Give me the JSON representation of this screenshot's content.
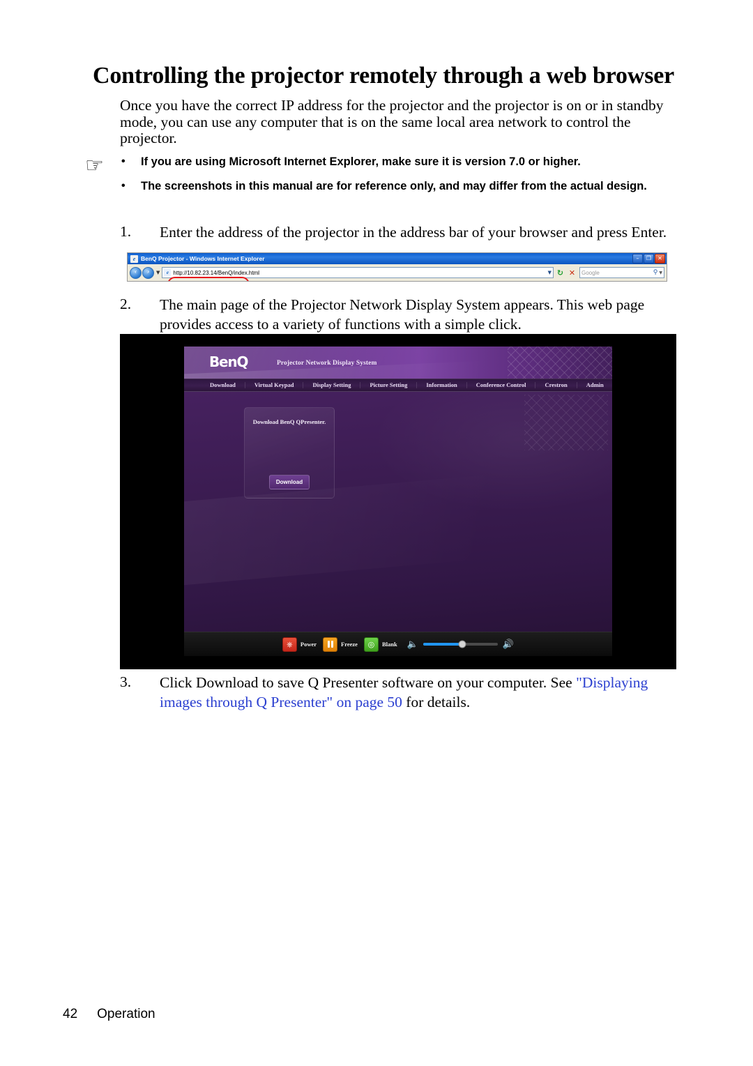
{
  "page": {
    "title": "Controlling the projector remotely through a web browser",
    "intro": "Once you have the correct IP address for the projector and the projector is on or in standby mode, you can use any computer that is on the same local area network to control the projector.",
    "footer_page_number": "42",
    "footer_section": "Operation"
  },
  "notes": {
    "icon": "pointing-hand-icon",
    "bullet": "•",
    "items": [
      "If you are using Microsoft Internet Explorer, make sure it is version 7.0 or higher.",
      "The screenshots in this manual are for reference only, and may differ from the actual design."
    ]
  },
  "steps": [
    {
      "number": "1.",
      "text": "Enter the address of the projector in the address bar of your browser and press Enter."
    },
    {
      "number": "2.",
      "text": "The main page of the Projector Network Display System appears. This web page provides access to a variety of functions with a simple click."
    },
    {
      "number": "3.",
      "text_before": "Click Download to save Q Presenter software on your computer. See ",
      "link_text": "\"Displaying images through Q Presenter\" on page 50",
      "text_after": " for details.",
      "link_color": "#2b3fd0"
    }
  ],
  "browser_screenshot": {
    "window_title": "BenQ Projector - Windows Internet Explorer",
    "favicon": "ie-favicon-icon",
    "back_icon": "‹",
    "forward_icon": "›",
    "history_caret": "▼",
    "address_value": "http://10.82.23.14/BenQ/index.html",
    "address_dropdown_icon": "▼",
    "refresh_icon": "↻",
    "stop_icon": "✕",
    "search_placeholder": "Google",
    "search_icon": "⚲",
    "search_caret": "▼",
    "minimize_icon": "–",
    "maximize_icon": "❐",
    "close_icon": "✕",
    "highlight_color": "#e8161c"
  },
  "web_page": {
    "logo": "BenQ",
    "subtitle": "Projector Network Display System",
    "nav_items": [
      "Download",
      "Virtual Keypad",
      "Display Setting",
      "Picture Setting",
      "Information",
      "Conference Control",
      "Crestron",
      "Admin"
    ],
    "panel": {
      "text": "Download BenQ QPresenter.",
      "button_label": "Download"
    },
    "controls": [
      {
        "label": "Power",
        "icon": "power-icon",
        "color": "#c5261a"
      },
      {
        "label": "Freeze",
        "icon": "pause-icon",
        "color": "#e08106"
      },
      {
        "label": "Blank",
        "icon": "blank-screen-icon",
        "color": "#3fa01c"
      }
    ],
    "volume": {
      "mute_icon": "speaker-low-icon",
      "max_icon": "speaker-high-icon",
      "level_percent": 52
    },
    "accent_color": "#5c2f7d",
    "background_color": "#3b1c51"
  }
}
